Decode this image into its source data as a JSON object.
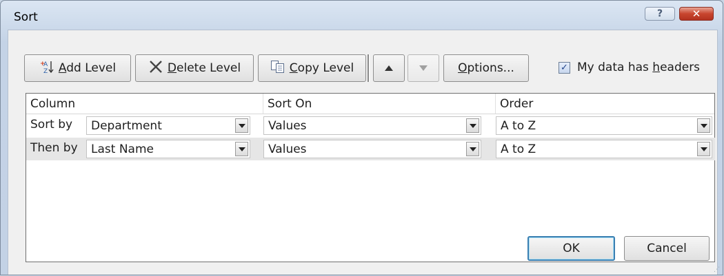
{
  "dialog": {
    "title": "Sort",
    "help_label": "?",
    "close_label": "✕"
  },
  "toolbar": {
    "add_level_prefix": "",
    "add_level_underline": "A",
    "add_level_rest": "dd Level",
    "delete_level_underline": "D",
    "delete_level_rest": "elete Level",
    "copy_level_underline": "C",
    "copy_level_rest": "opy Level",
    "options_underline": "O",
    "options_rest": "ptions...",
    "headers_prefix": "My data has ",
    "headers_underline": "h",
    "headers_rest": "eaders",
    "headers_checked": true
  },
  "grid": {
    "headers": {
      "column": "Column",
      "sort_on": "Sort On",
      "order": "Order"
    },
    "rows": [
      {
        "label": "Sort by",
        "column": "Department",
        "sort_on": "Values",
        "order": "A to Z",
        "selected": false
      },
      {
        "label": "Then by",
        "column": "Last Name",
        "sort_on": "Values",
        "order": "A to Z",
        "selected": true
      }
    ]
  },
  "footer": {
    "ok_label": "OK",
    "cancel_label": "Cancel"
  },
  "colors": {
    "chrome": "#c9d6e6",
    "panel": "#f0f0f0",
    "selected_row": "#e6e6e6",
    "close_red": "#c8452e"
  }
}
